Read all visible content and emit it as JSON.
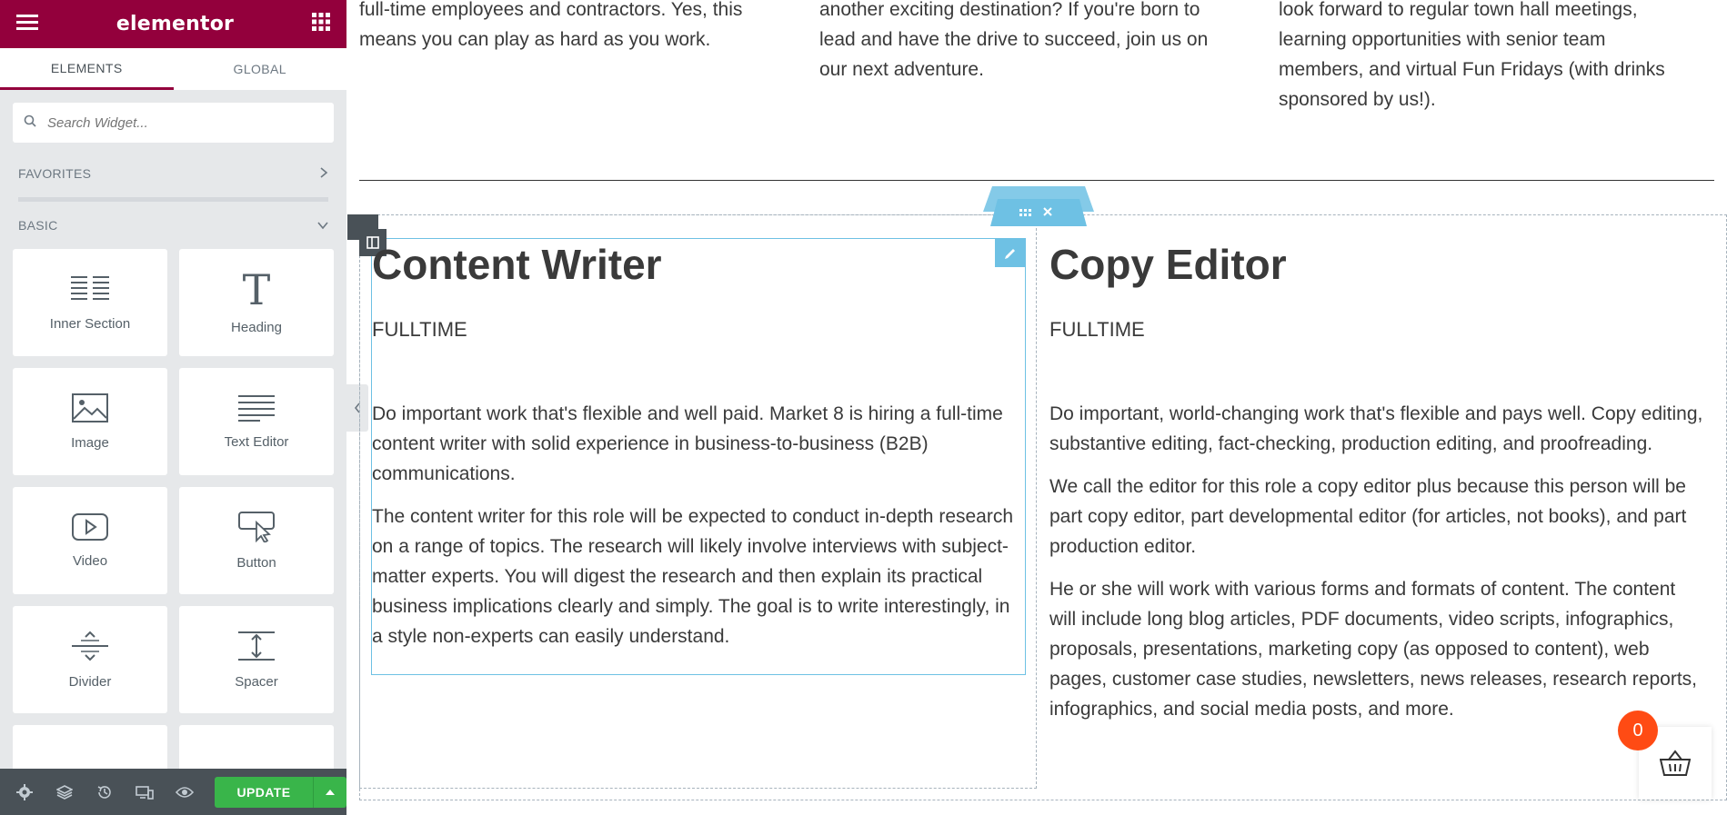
{
  "editor": {
    "logo": "elementor",
    "tabs": [
      {
        "label": "ELEMENTS"
      },
      {
        "label": "GLOBAL"
      }
    ],
    "search_placeholder": "Search Widget...",
    "categories": [
      {
        "label": "FAVORITES"
      },
      {
        "label": "BASIC"
      }
    ],
    "widgets": [
      {
        "label": "Inner Section",
        "icon": "inner-section-icon"
      },
      {
        "label": "Heading",
        "icon": "heading-icon"
      },
      {
        "label": "Image",
        "icon": "image-icon"
      },
      {
        "label": "Text Editor",
        "icon": "text-editor-icon"
      },
      {
        "label": "Video",
        "icon": "video-icon"
      },
      {
        "label": "Button",
        "icon": "button-icon"
      },
      {
        "label": "Divider",
        "icon": "divider-icon"
      },
      {
        "label": "Spacer",
        "icon": "spacer-icon"
      }
    ],
    "update_label": "UPDATE",
    "accent_color": "#93003c",
    "update_color": "#39b54a"
  },
  "page": {
    "top_columns": [
      {
        "lines": [
          "full-time employees and contractors. Yes, this",
          "means you can play as hard as you work."
        ]
      },
      {
        "lines": [
          "another exciting destination? If you're born to",
          "lead and have the drive to succeed, join us on",
          "our next adventure."
        ]
      },
      {
        "lines": [
          "look forward to regular town hall meetings,",
          "learning opportunities with senior team",
          "members, and virtual Fun Fridays (with drinks",
          "sponsored by us!)."
        ]
      }
    ],
    "jobs": [
      {
        "title": "Content Writer",
        "type": "FULLTIME",
        "paragraphs": [
          "Do important work that's flexible and well paid. Market 8 is hiring a full-time content writer with solid experience in business-to-business (B2B) communications.",
          "The content writer for this role will be expected to conduct in-depth research on a range of topics. The research will likely involve interviews with subject-matter experts. You will digest the research and then explain its practical business implications clearly and simply. The goal is to write interestingly, in a style non-experts can easily understand."
        ]
      },
      {
        "title": "Copy Editor",
        "type": "FULLTIME",
        "paragraphs": [
          "Do important, world-changing work that's flexible and pays well. Copy editing, substantive editing, fact-checking, production editing, and proofreading.",
          "We call the editor for this role a copy editor plus because this person will be part copy editor, part developmental editor (for articles, not books), and part production editor.",
          "He or she will work with various forms and formats of content. The content will include long blog articles, PDF documents, video scripts, infographics, proposals, presentations, marketing copy (as opposed to content), web pages, customer case studies, newsletters, news releases, research reports, infographics, and social media posts, and more."
        ]
      }
    ],
    "cart_count": "0",
    "badge_color": "#ff4b14"
  }
}
